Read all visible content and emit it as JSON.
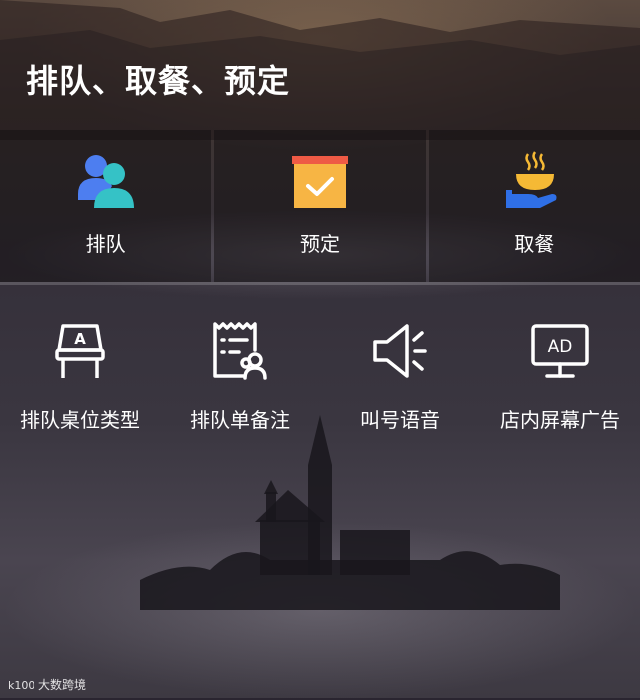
{
  "header": {
    "title": "排队、取餐、预定"
  },
  "primary_actions": [
    {
      "label": "排队",
      "icon": "people-icon"
    },
    {
      "label": "预定",
      "icon": "reservation-box-icon"
    },
    {
      "label": "取餐",
      "icon": "meal-pickup-icon"
    }
  ],
  "settings": [
    {
      "label": "排队桌位类型",
      "icon": "table-type-icon"
    },
    {
      "label": "排队单备注",
      "icon": "queue-note-icon"
    },
    {
      "label": "叫号语音",
      "icon": "speaker-icon"
    },
    {
      "label": "店内屏幕广告",
      "icon": "ad-screen-icon"
    }
  ],
  "watermark": {
    "logo_text": "k100",
    "text": "大数跨境"
  },
  "colors": {
    "people_blue": "#4d7ef0",
    "people_teal": "#35c2c6",
    "box_orange": "#f7b544",
    "box_red": "#ee5a45",
    "bowl_yellow": "#f5b935",
    "hand_blue": "#2f6fe6"
  }
}
